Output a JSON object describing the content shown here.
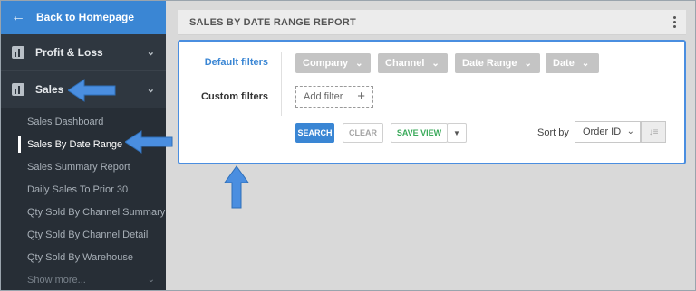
{
  "sidebar": {
    "back_label": "Back to Homepage",
    "menu": [
      {
        "label": "Profit & Loss"
      },
      {
        "label": "Sales"
      }
    ],
    "sub_items": [
      "Sales Dashboard",
      "Sales By Date Range",
      "Sales Summary Report",
      "Daily Sales To Prior 30",
      "Qty Sold By Channel Summary",
      "Qty Sold By Channel Detail",
      "Qty Sold By Warehouse",
      "Show more..."
    ]
  },
  "report": {
    "title": "SALES BY DATE RANGE REPORT"
  },
  "filters": {
    "default_label": "Default filters",
    "custom_label": "Custom filters",
    "chips": [
      "Company",
      "Channel",
      "Date Range",
      "Date"
    ],
    "add_filter": "Add filter"
  },
  "actions": {
    "search": "SEARCH",
    "clear": "CLEAR",
    "save_view": "SAVE VIEW"
  },
  "sort": {
    "label": "Sort by",
    "value": "Order ID"
  },
  "colors": {
    "accent": "#3a86d4",
    "annotation": "#4a8ee0",
    "sidebar_bg": "#2f3740",
    "save_green": "#3aaa5a"
  }
}
